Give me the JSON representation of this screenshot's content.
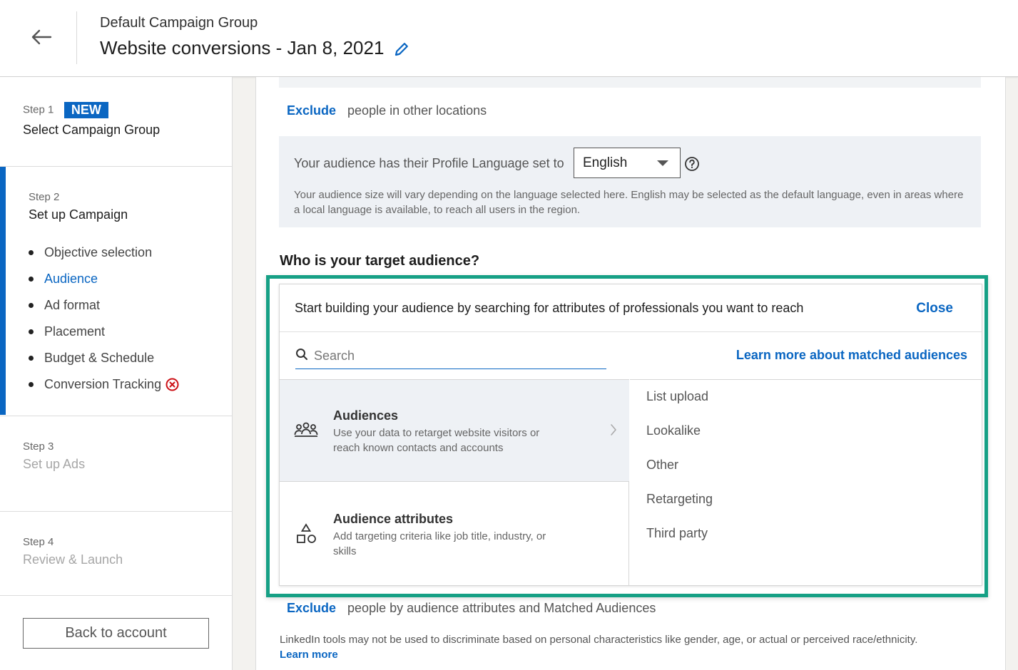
{
  "header": {
    "group_name": "Default Campaign Group",
    "campaign_title": "Website conversions - Jan 8, 2021"
  },
  "sidebar": {
    "steps": [
      {
        "label": "Step 1",
        "badge": "NEW",
        "title": "Select Campaign Group"
      },
      {
        "label": "Step 2",
        "title": "Set up Campaign",
        "items": [
          {
            "label": "Objective selection",
            "active": false
          },
          {
            "label": "Audience",
            "active": true
          },
          {
            "label": "Ad format",
            "active": false
          },
          {
            "label": "Placement",
            "active": false
          },
          {
            "label": "Budget & Schedule",
            "active": false
          },
          {
            "label": "Conversion Tracking",
            "active": false,
            "error": true
          }
        ]
      },
      {
        "label": "Step 3",
        "title": "Set up Ads"
      },
      {
        "label": "Step 4",
        "title": "Review & Launch"
      }
    ],
    "back_button": "Back to account"
  },
  "main": {
    "exclude_locations": {
      "link": "Exclude",
      "text": "people in other locations"
    },
    "language": {
      "prompt": "Your audience has their Profile Language set to",
      "selected": "English",
      "note": "Your audience size will vary depending on the language selected here. English may be selected as the default language, even in areas where a local language is available, to reach all users in the region."
    },
    "target_heading": "Who is your target audience?",
    "builder": {
      "intro": "Start building your audience by searching for attributes of professionals you want to reach",
      "close": "Close",
      "search_placeholder": "Search",
      "learn_matched": "Learn more about matched audiences",
      "categories": [
        {
          "title": "Audiences",
          "description": "Use your data to retarget website visitors or reach known contacts and accounts",
          "icon": "people-group-icon"
        },
        {
          "title": "Audience attributes",
          "description": "Add targeting criteria like job title, industry, or skills",
          "icon": "shapes-icon"
        }
      ],
      "subcategories": [
        "List upload",
        "Lookalike",
        "Other",
        "Retargeting",
        "Third party"
      ]
    },
    "exclude_attributes": {
      "link": "Exclude",
      "text": "people by audience attributes and Matched Audiences"
    },
    "legal": {
      "text": "LinkedIn tools may not be used to discriminate based on personal characteristics like gender, age, or actual or perceived race/ethnicity.",
      "learn_more": "Learn more"
    }
  },
  "colors": {
    "brand_blue": "#0a66c2",
    "highlight_green": "#16a085",
    "error_red": "#cc1016"
  }
}
